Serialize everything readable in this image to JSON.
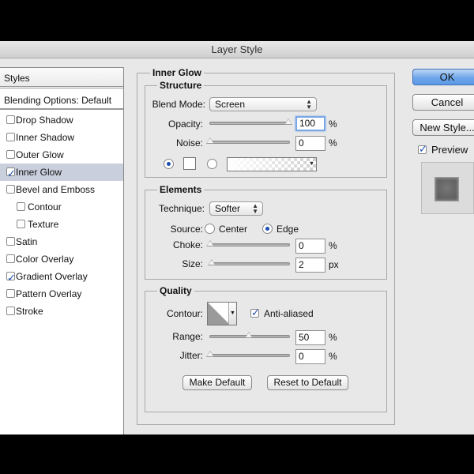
{
  "window": {
    "title": "Layer Style"
  },
  "styles_panel": {
    "header": "Styles",
    "blending_options": "Blending Options: Default",
    "items": [
      {
        "label": "Drop Shadow",
        "checked": false,
        "selected": false,
        "indent": false
      },
      {
        "label": "Inner Shadow",
        "checked": false,
        "selected": false,
        "indent": false
      },
      {
        "label": "Outer Glow",
        "checked": false,
        "selected": false,
        "indent": false
      },
      {
        "label": "Inner Glow",
        "checked": true,
        "selected": true,
        "indent": false
      },
      {
        "label": "Bevel and Emboss",
        "checked": false,
        "selected": false,
        "indent": false
      },
      {
        "label": "Contour",
        "checked": false,
        "selected": false,
        "indent": true
      },
      {
        "label": "Texture",
        "checked": false,
        "selected": false,
        "indent": true
      },
      {
        "label": "Satin",
        "checked": false,
        "selected": false,
        "indent": false
      },
      {
        "label": "Color Overlay",
        "checked": false,
        "selected": false,
        "indent": false
      },
      {
        "label": "Gradient Overlay",
        "checked": true,
        "selected": false,
        "indent": false
      },
      {
        "label": "Pattern Overlay",
        "checked": false,
        "selected": false,
        "indent": false
      },
      {
        "label": "Stroke",
        "checked": false,
        "selected": false,
        "indent": false
      }
    ]
  },
  "buttons": {
    "ok": "OK",
    "cancel": "Cancel",
    "new_style": "New Style...",
    "preview_label": "Preview",
    "preview_checked": true
  },
  "inner_glow": {
    "title": "Inner Glow",
    "structure": {
      "title": "Structure",
      "blend_mode_label": "Blend Mode:",
      "blend_mode_value": "Screen",
      "opacity_label": "Opacity:",
      "opacity_value": "100",
      "opacity_unit": "%",
      "opacity_slider": 1.0,
      "noise_label": "Noise:",
      "noise_value": "0",
      "noise_unit": "%",
      "noise_slider": 0.0,
      "color_mode": "solid"
    },
    "elements": {
      "title": "Elements",
      "technique_label": "Technique:",
      "technique_value": "Softer",
      "source_label": "Source:",
      "source_center": "Center",
      "source_edge": "Edge",
      "source_selected": "Edge",
      "choke_label": "Choke:",
      "choke_value": "0",
      "choke_unit": "%",
      "choke_slider": 0.0,
      "size_label": "Size:",
      "size_value": "2",
      "size_unit": "px",
      "size_slider": 0.02
    },
    "quality": {
      "title": "Quality",
      "contour_label": "Contour:",
      "anti_aliased_label": "Anti-aliased",
      "anti_aliased_checked": true,
      "range_label": "Range:",
      "range_value": "50",
      "range_unit": "%",
      "range_slider": 0.5,
      "jitter_label": "Jitter:",
      "jitter_value": "0",
      "jitter_unit": "%",
      "jitter_slider": 0.0
    },
    "make_default": "Make Default",
    "reset_to_default": "Reset to Default"
  }
}
